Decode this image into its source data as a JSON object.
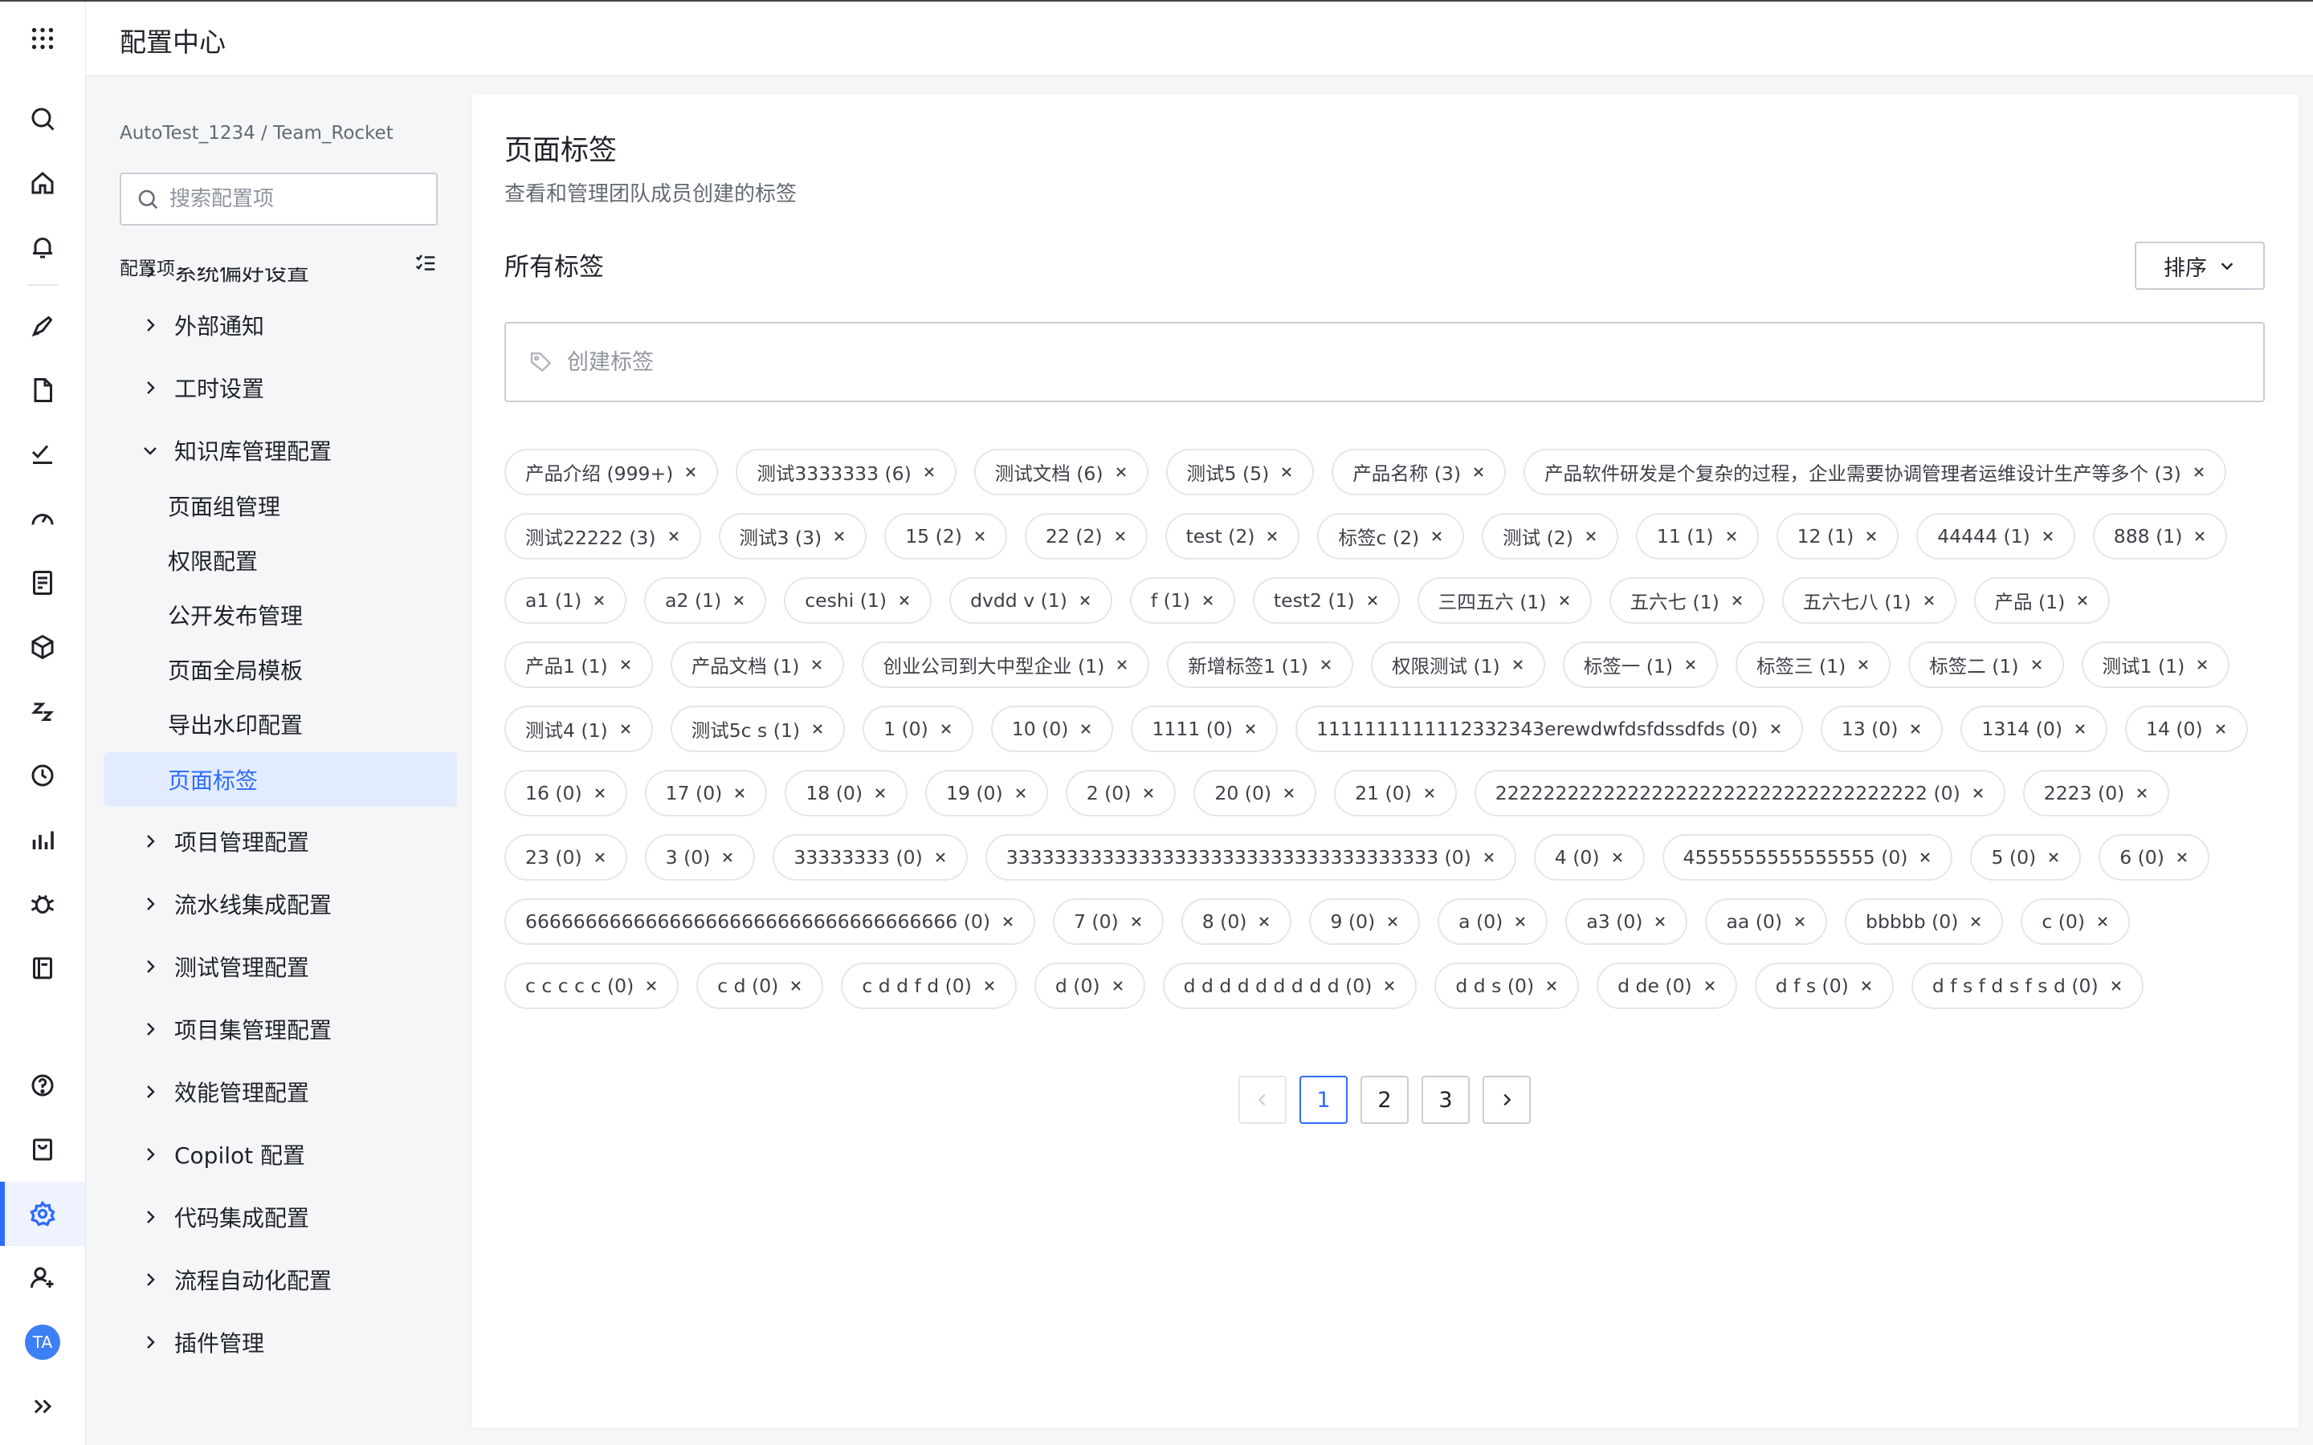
{
  "header": {
    "title": "配置中心"
  },
  "rail": {
    "avatar": "TA",
    "icons": [
      "apps-grid-icon",
      "search-icon",
      "home-icon",
      "bell-icon",
      "rocket-icon",
      "document-icon",
      "task-check-icon",
      "dashboard-gauge-icon",
      "notes-icon",
      "cube-icon",
      "sleep-icon",
      "clock-icon",
      "analytics-icon",
      "bug-icon",
      "book-icon",
      "help-icon",
      "inbox-icon",
      "settings-icon",
      "add-user-icon",
      "avatar",
      "expand-icon"
    ]
  },
  "sidebar": {
    "breadcrumb": "AutoTest_1234 / Team_Rocket",
    "search_placeholder": "搜索配置项",
    "config_label": "配置项",
    "items": [
      {
        "label": "系统偏好设置",
        "type": "group"
      },
      {
        "label": "外部通知",
        "type": "group"
      },
      {
        "label": "工时设置",
        "type": "group"
      },
      {
        "label": "知识库管理配置",
        "type": "group-open"
      },
      {
        "label": "页面组管理",
        "type": "sub"
      },
      {
        "label": "权限配置",
        "type": "sub"
      },
      {
        "label": "公开发布管理",
        "type": "sub"
      },
      {
        "label": "页面全局模板",
        "type": "sub"
      },
      {
        "label": "导出水印配置",
        "type": "sub"
      },
      {
        "label": "页面标签",
        "type": "sub-active"
      },
      {
        "label": "项目管理配置",
        "type": "group"
      },
      {
        "label": "流水线集成配置",
        "type": "group"
      },
      {
        "label": "测试管理配置",
        "type": "group"
      },
      {
        "label": "项目集管理配置",
        "type": "group"
      },
      {
        "label": "效能管理配置",
        "type": "group"
      },
      {
        "label": "Copilot 配置",
        "type": "group"
      },
      {
        "label": "代码集成配置",
        "type": "group"
      },
      {
        "label": "流程自动化配置",
        "type": "group"
      },
      {
        "label": "插件管理",
        "type": "group"
      }
    ]
  },
  "main": {
    "title": "页面标签",
    "subtitle": "查看和管理团队成员创建的标签",
    "section_title": "所有标签",
    "sort_label": "排序",
    "create_placeholder": "创建标签",
    "tags": [
      "产品介绍 (999+)",
      "测试3333333 (6)",
      "测试文档 (6)",
      "测试5 (5)",
      "产品名称 (3)",
      "产品软件研发是个复杂的过程，企业需要协调管理者运维设计生产等多个 (3)",
      "测试22222 (3)",
      "测试3 (3)",
      "15 (2)",
      "22 (2)",
      "test (2)",
      "标签c (2)",
      "测试 (2)",
      "11 (1)",
      "12 (1)",
      "44444 (1)",
      "888 (1)",
      "a1 (1)",
      "a2 (1)",
      "ceshi (1)",
      "dvdd v (1)",
      "f (1)",
      "test2 (1)",
      "三四五六 (1)",
      "五六七 (1)",
      "五六七八 (1)",
      "产品 (1)",
      "产品1 (1)",
      "产品文档 (1)",
      "创业公司到大中型企业 (1)",
      "新增标签1 (1)",
      "权限测试 (1)",
      "标签一 (1)",
      "标签三 (1)",
      "标签二 (1)",
      "测试1 (1)",
      "测试4 (1)",
      "测试5c s (1)",
      "1 (0)",
      "10 (0)",
      "1111 (0)",
      "1111111111112332343erewdwfdsfdssdfds (0)",
      "13 (0)",
      "1314 (0)",
      "14 (0)",
      "16 (0)",
      "17 (0)",
      "18 (0)",
      "19 (0)",
      "2 (0)",
      "20 (0)",
      "21 (0)",
      "222222222222222222222222222222222222 (0)",
      "2223 (0)",
      "23 (0)",
      "3 (0)",
      "33333333 (0)",
      "333333333333333333333333333333333333 (0)",
      "4 (0)",
      "4555555555555555 (0)",
      "5 (0)",
      "6 (0)",
      "666666666666666666666666666666666666 (0)",
      "7 (0)",
      "8 (0)",
      "9 (0)",
      "a (0)",
      "a3 (0)",
      "aa (0)",
      "bbbbb (0)",
      "c (0)",
      "c c c c c (0)",
      "c d (0)",
      "c d d f d (0)",
      "d (0)",
      "d d d d d d d d d (0)",
      "d d s (0)",
      "d de (0)",
      "d f s (0)",
      "d f s f d s f s d (0)"
    ],
    "pagination": {
      "pages": [
        "1",
        "2",
        "3"
      ],
      "current": "1"
    }
  },
  "colors": {
    "accent": "#2f6bff",
    "active_bg": "#e3ecff",
    "border": "#c9cdd4",
    "tag_border": "#e5e6eb"
  }
}
